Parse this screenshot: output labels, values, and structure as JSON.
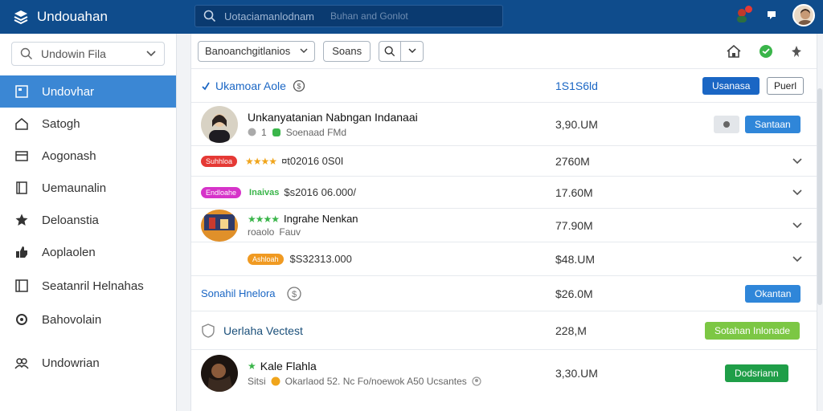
{
  "topbar": {
    "app_title": "Undouahan",
    "search_placeholder": "Uotaciamanlodnam",
    "search_hint": "Buhan and Gonlot"
  },
  "sidebar": {
    "select_label": "Undowin Fila",
    "items": [
      {
        "label": "Undovhar",
        "icon": "document-icon",
        "active": true
      },
      {
        "label": "Satogh",
        "icon": "home-icon",
        "active": false
      },
      {
        "label": "Aogonash",
        "icon": "inbox-icon",
        "active": false
      },
      {
        "label": "Uemaunalin",
        "icon": "bookmark-icon",
        "active": false
      },
      {
        "label": "Deloanstia",
        "icon": "star-icon",
        "active": false
      },
      {
        "label": "Aoplaolen",
        "icon": "thumbs-up-icon",
        "active": false
      },
      {
        "label": "Seatanril Helnahas",
        "icon": "panel-icon",
        "active": false
      },
      {
        "label": "Bahovolain",
        "icon": "gear-icon",
        "active": false
      },
      {
        "label": "Undowrian",
        "icon": "people-icon",
        "active": false
      }
    ]
  },
  "toolbar": {
    "select_label": "Banoanchgitlanios",
    "button_label": "Soans"
  },
  "header_row": {
    "label": "Ukamoar Aole",
    "amount": "1S1S6ld",
    "primary_button": "Usanasa",
    "secondary_button": "Puerl"
  },
  "rows": [
    {
      "title": "Unkanyatanian Nabngan Indanaai",
      "sub": "Soenaad FMd",
      "sub_prefix": "1",
      "amount": "3,90.UM",
      "button": "Santaan"
    },
    {
      "pill": "Suhhloa",
      "pill_color": "#e53935",
      "detail": "¤t02016 0S0I",
      "amount": "2760M"
    },
    {
      "pill": "Endloahe",
      "pill_color": "#d633c9",
      "tag": "Inaivas",
      "detail": "$s2016 06.000/",
      "amount": "17.60M"
    },
    {
      "title": "Ingrahe Nenkan",
      "sub": "Fauv",
      "sub_prefix": "roaolo",
      "amount": "77.90M"
    },
    {
      "pill": "Ashloah",
      "pill_color": "#f09a22",
      "detail": "$S32313.000",
      "amount": "$48.UM"
    },
    {
      "link": "Sonahil Hnelora",
      "amount": "$26.0M",
      "button": "Okantan"
    },
    {
      "title": "Uerlaha Vectest",
      "amount": "228,M",
      "button": "Sotahan Inlonade"
    },
    {
      "title": "Kale Flahla",
      "sub": "Okarlaod 52. Nc Fo/noewok A50 Ucsantes",
      "sub_prefix": "Sitsi",
      "amount": "3,30.UM",
      "button": "Dodsriann"
    }
  ]
}
